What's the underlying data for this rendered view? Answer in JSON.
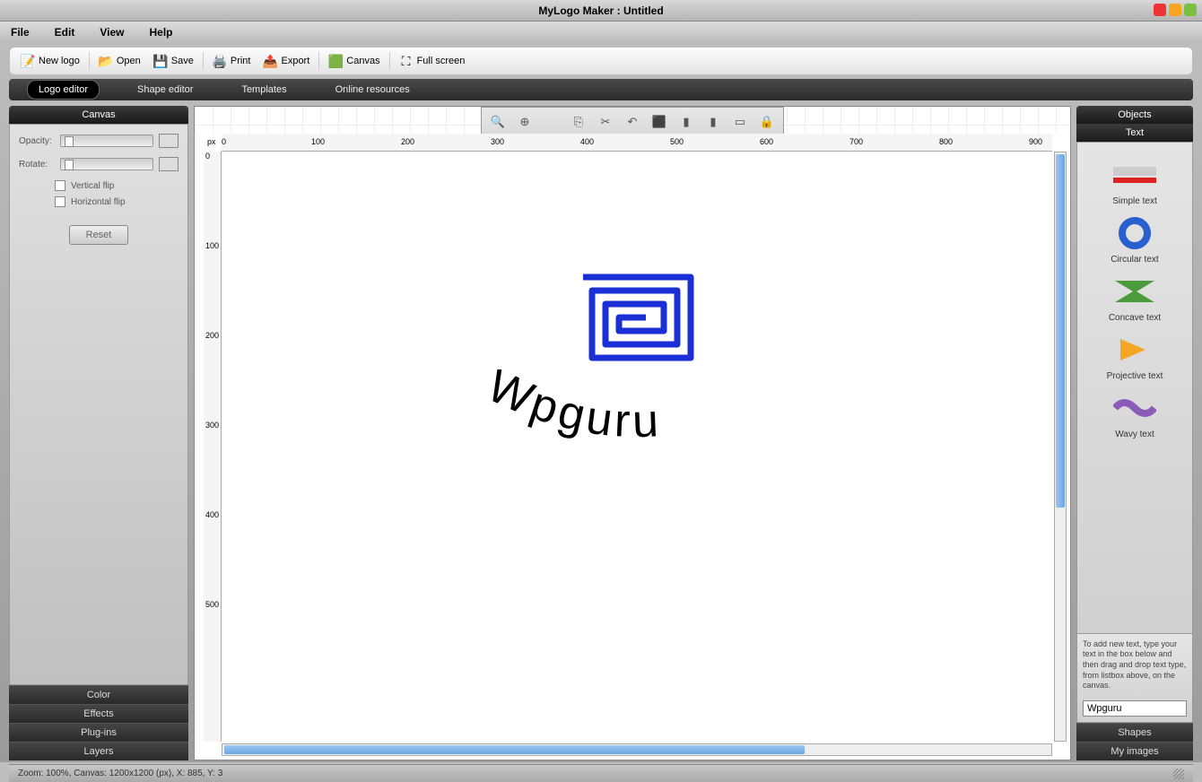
{
  "window": {
    "title": "MyLogo Maker : Untitled"
  },
  "menubar": {
    "file": "File",
    "edit": "Edit",
    "view": "View",
    "help": "Help"
  },
  "toolbar": {
    "new": "New logo",
    "open": "Open",
    "save": "Save",
    "print": "Print",
    "export": "Export",
    "canvas": "Canvas",
    "fullscreen": "Full screen"
  },
  "tabs": {
    "logo": "Logo editor",
    "shape": "Shape editor",
    "templates": "Templates",
    "online": "Online resources"
  },
  "left": {
    "header": "Canvas",
    "opacity": "Opacity:",
    "rotate": "Rotate:",
    "vflip": "Vertical flip",
    "hflip": "Horizontal flip",
    "reset": "Reset",
    "footer": {
      "color": "Color",
      "effects": "Effects",
      "plugins": "Plug-ins",
      "layers": "Layers"
    }
  },
  "canvas": {
    "px": "px",
    "ruler_h": [
      "0",
      "100",
      "200",
      "300",
      "400",
      "500",
      "600",
      "700",
      "800",
      "900"
    ],
    "ruler_v": [
      "0",
      "100",
      "200",
      "300",
      "400",
      "500"
    ],
    "logo_text": "Wpguru"
  },
  "right": {
    "objects": "Objects",
    "text_header": "Text",
    "items": {
      "simple": "Simple text",
      "circular": "Circular text",
      "concave": "Concave text",
      "projective": "Projective text",
      "wavy": "Wavy text"
    },
    "help": "To add new text, type your text in the box below and then drag and drop text type, from listbox above, on the canvas.",
    "input_value": "Wpguru",
    "shapes": "Shapes",
    "myimages": "My images"
  },
  "status": "Zoom: 100%, Canvas: 1200x1200 (px), X: 885, Y: 3"
}
